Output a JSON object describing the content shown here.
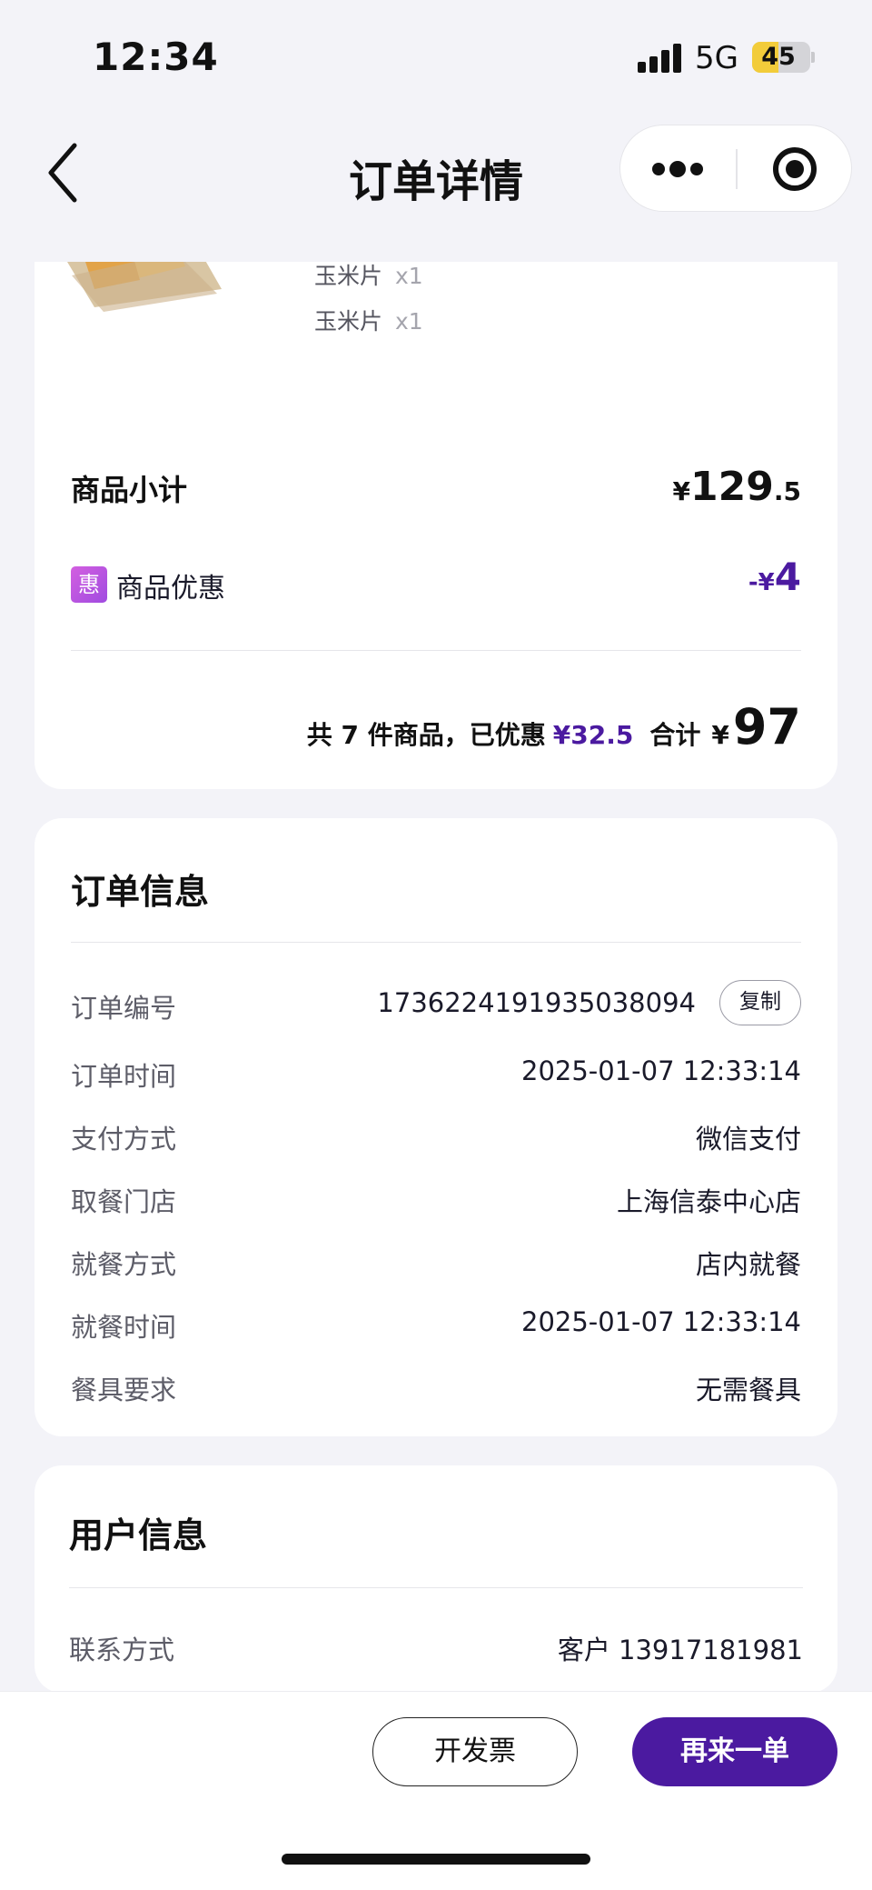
{
  "status_bar": {
    "time": "12:34",
    "network": "5G",
    "battery": "45",
    "battery_level": 0.45
  },
  "nav": {
    "title": "订单详情"
  },
  "items": [
    {
      "name": "玉米片",
      "qty": "x1"
    },
    {
      "name": "玉米片",
      "qty": "x1"
    }
  ],
  "price": {
    "subtotal_label": "商品小计",
    "subtotal_currency": "¥",
    "subtotal_int": "129",
    "subtotal_dec": ".5",
    "discount_icon": "惠",
    "discount_label": "商品优惠",
    "discount_prefix": "-¥",
    "discount_value": "4",
    "summary_prefix": "共 7 件商品，已优惠",
    "summary_saved": "¥32.5",
    "summary_total_label": "合计",
    "summary_currency": "¥",
    "summary_total": "97"
  },
  "order_info": {
    "title": "订单信息",
    "rows": [
      {
        "label": "订单编号",
        "value": "1736224191935038094"
      },
      {
        "label": "订单时间",
        "value": "2025-01-07 12:33:14"
      },
      {
        "label": "支付方式",
        "value": "微信支付"
      },
      {
        "label": "取餐门店",
        "value": "上海信泰中心店"
      },
      {
        "label": "就餐方式",
        "value": "店内就餐"
      },
      {
        "label": "就餐时间",
        "value": "2025-01-07 12:33:14"
      },
      {
        "label": "餐具要求",
        "value": "无需餐具"
      }
    ],
    "copy_label": "复制"
  },
  "user_info": {
    "title": "用户信息",
    "contact_label": "联系方式",
    "contact_value": "客户 13917181981"
  },
  "actions": {
    "invoice_label": "开发票",
    "reorder_label": "再来一单"
  },
  "colors": {
    "accent": "#4b1aa0",
    "background": "#f3f3f8"
  },
  "icons": [
    "signal-icon",
    "battery-icon",
    "back-arrow-icon",
    "more-dots-icon",
    "target-icon",
    "discount-badge-icon"
  ]
}
